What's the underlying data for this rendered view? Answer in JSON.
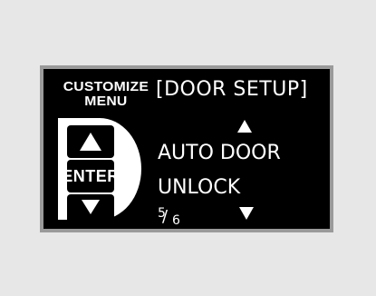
{
  "colors": {
    "page_background": "#e7e7e7",
    "bezel": "#9a9a9a",
    "display_background": "#000000",
    "display_foreground": "#ffffff"
  },
  "controls": {
    "heading_line1": "CUSTOMIZE",
    "heading_line2": "MENU",
    "up_button_icon": "triangle-up-icon",
    "enter_label": "ENTER",
    "down_button_icon": "triangle-down-icon"
  },
  "display": {
    "title": "[DOOR SETUP]",
    "scroll_up_icon": "triangle-up-icon",
    "items": [
      "AUTO DOOR",
      "UNLOCK"
    ],
    "page": {
      "current": "5",
      "separator": "/",
      "total": "6"
    },
    "scroll_down_icon": "triangle-down-icon"
  }
}
